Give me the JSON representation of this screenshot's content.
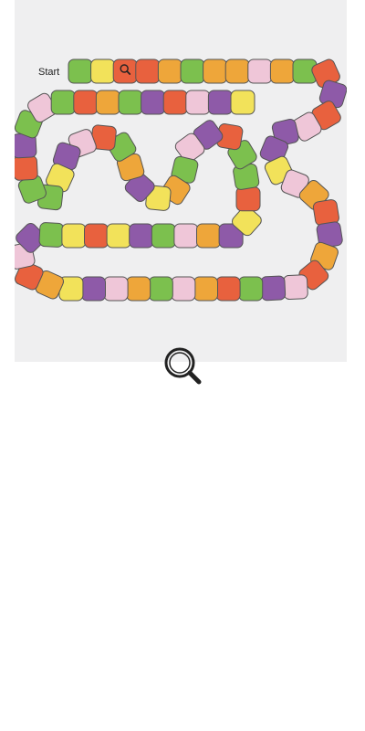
{
  "board": {
    "start_label": "Start",
    "colors": {
      "green": "#7cc04e",
      "yellow": "#f2e25a",
      "red": "#e8613e",
      "orange": "#eea63a",
      "purple": "#8e5aa8",
      "pink": "#efc6d8",
      "outline": "#555555",
      "background": "#efeff0"
    },
    "tile_sequence": [
      "green",
      "yellow",
      "red",
      "red",
      "orange",
      "green",
      "orange",
      "orange",
      "pink",
      "orange",
      "green",
      "red",
      "purple",
      "red",
      "pink",
      "purple",
      "purple",
      "yellow",
      "pink",
      "orange",
      "red",
      "purple",
      "orange",
      "red",
      "pink",
      "purple",
      "green",
      "red",
      "orange",
      "pink",
      "green",
      "orange",
      "pink",
      "purple",
      "yellow",
      "orange",
      "red",
      "pink",
      "purple",
      "green",
      "yellow",
      "red",
      "yellow",
      "purple",
      "green",
      "pink",
      "orange",
      "purple",
      "yellow",
      "red",
      "green",
      "green",
      "red",
      "purple",
      "pink",
      "green",
      "orange",
      "yellow",
      "purple",
      "orange",
      "green",
      "red",
      "pink",
      "purple",
      "yellow",
      "green",
      "green",
      "red",
      "purple",
      "green",
      "pink",
      "green",
      "red",
      "orange",
      "green",
      "purple",
      "red",
      "pink",
      "purple",
      "yellow"
    ],
    "marker_icon": "magnifier-icon"
  },
  "controls": {
    "zoom_icon": "magnifier-icon"
  }
}
